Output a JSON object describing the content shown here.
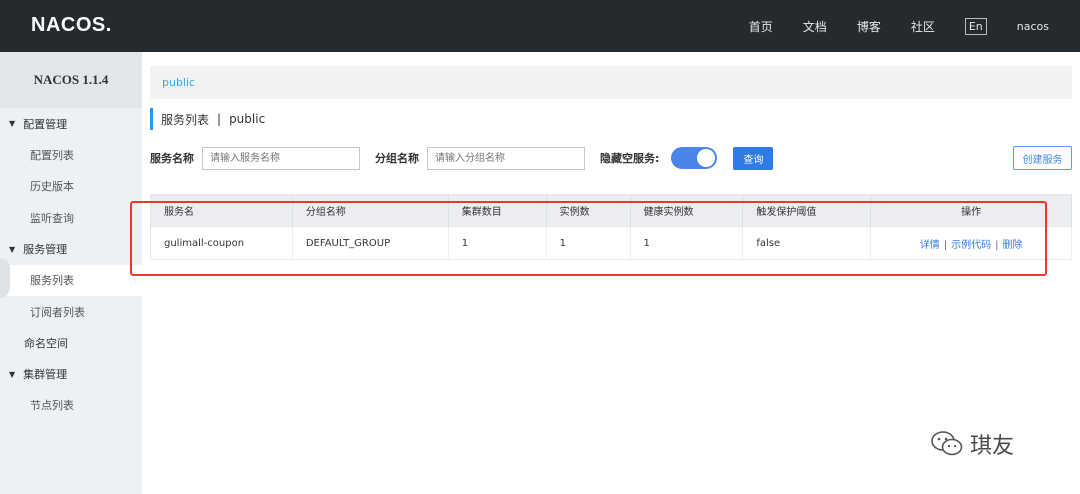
{
  "header": {
    "logo": "NACOS.",
    "nav": [
      "首页",
      "文档",
      "博客",
      "社区"
    ],
    "lang": "En",
    "user": "nacos"
  },
  "sidebar": {
    "version": "NACOS 1.1.4",
    "groups": [
      {
        "label": "配置管理",
        "items": [
          "配置列表",
          "历史版本",
          "监听查询"
        ]
      },
      {
        "label": "服务管理",
        "items": [
          "服务列表",
          "订阅者列表"
        ]
      }
    ],
    "namespace": "命名空间",
    "cluster": {
      "label": "集群管理",
      "items": [
        "节点列表"
      ]
    },
    "active_item": "服务列表"
  },
  "breadcrumb": {
    "namespace": "public"
  },
  "title": {
    "main": "服务列表",
    "sep": "|",
    "namespace": "public"
  },
  "filters": {
    "service_label": "服务名称",
    "service_placeholder": "请输入服务名称",
    "group_label": "分组名称",
    "group_placeholder": "请输入分组名称",
    "hide_empty_label": "隐藏空服务:",
    "hide_empty_on": true,
    "query_label": "查询",
    "create_label": "创建服务"
  },
  "table": {
    "columns": [
      "服务名",
      "分组名称",
      "集群数目",
      "实例数",
      "健康实例数",
      "触发保护阈值",
      "操作"
    ],
    "rows": [
      {
        "name": "gulimall-coupon",
        "group": "DEFAULT_GROUP",
        "clusters": "1",
        "instances": "1",
        "healthy": "1",
        "threshold": "false"
      }
    ],
    "actions": {
      "detail": "详情",
      "sample": "示例代码",
      "delete": "删除",
      "sep": "|"
    }
  },
  "watermark": {
    "text": "琪友"
  },
  "colors": {
    "accent": "#2f7ae5",
    "topbar": "#252a2f",
    "highlight": "#e8392d"
  }
}
